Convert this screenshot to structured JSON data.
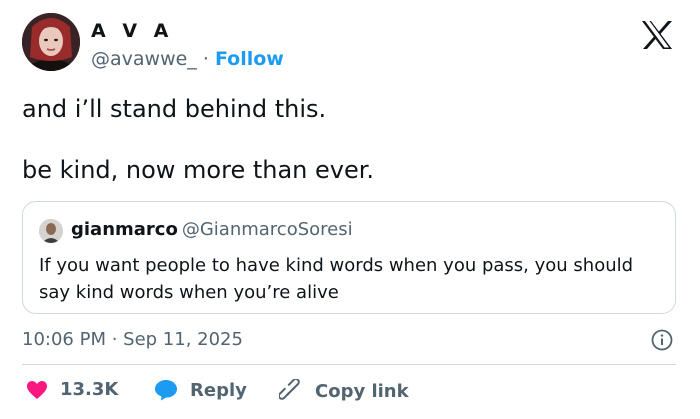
{
  "author": {
    "name": "A V A",
    "handle": "@avawwe_",
    "separator": "·",
    "follow_label": "Follow"
  },
  "tweet": {
    "line1": "and i’ll stand behind this.",
    "line2": "be kind, now more than ever."
  },
  "quoted": {
    "name": "gianmarco",
    "handle": "@GianmarcoSoresi",
    "text": "If you want people to have kind words when you pass, you should say kind words when you’re alive"
  },
  "timestamp": "10:06 PM · Sep 11, 2025",
  "actions": {
    "likes": "13.3K",
    "reply_label": "Reply",
    "copy_label": "Copy link"
  },
  "colors": {
    "like_red": "#f91880",
    "reply_blue": "#1d9bf0",
    "follow_blue": "#1d9bf0",
    "muted_gray": "#536471"
  },
  "icons": [
    "x-logo-icon",
    "info-icon",
    "heart-icon",
    "reply-bubble-icon",
    "link-icon"
  ]
}
